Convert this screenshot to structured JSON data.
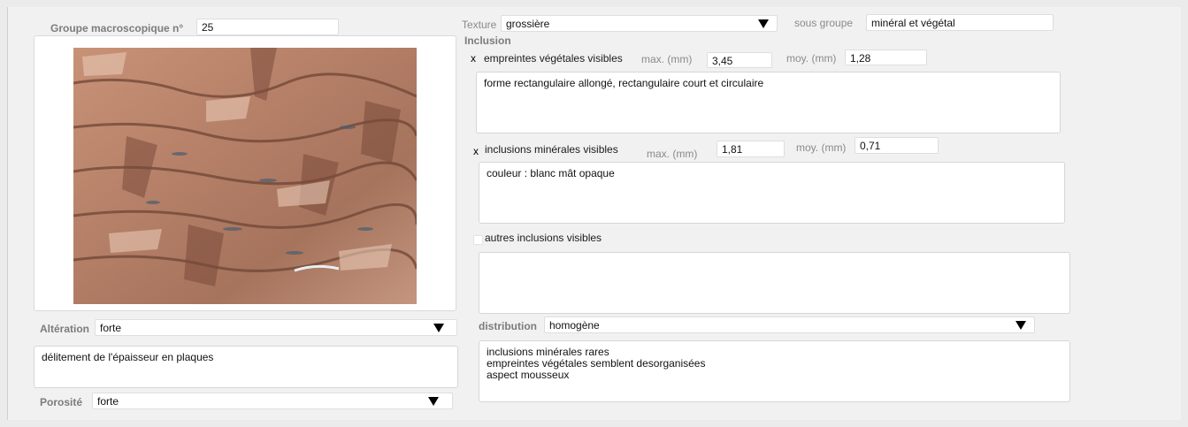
{
  "groupe": {
    "label": "Groupe macroscopique n°",
    "value": "25"
  },
  "texture": {
    "label": "Texture",
    "value": "grossière"
  },
  "sous_groupe": {
    "label": "sous groupe",
    "value": "minéral et végétal"
  },
  "inclusion": {
    "heading": "Inclusion",
    "empreintes": {
      "label": "empreintes végétales visibles",
      "checked_mark": "x",
      "max_label": "max. (mm)",
      "max_value": "3,45",
      "moy_label": "moy. (mm)",
      "moy_value": "1,28",
      "description": "forme rectangulaire allongé, rectangulaire court et circulaire"
    },
    "minerales": {
      "label": "inclusions minérales visibles",
      "checked_mark": "x",
      "max_label": "max. (mm)",
      "max_value": "1,81",
      "moy_label": "moy. (mm)",
      "moy_value": "0,71",
      "description": "couleur : blanc mât opaque"
    },
    "autres": {
      "label": "autres inclusions visibles",
      "description": ""
    }
  },
  "alteration": {
    "label": "Altération",
    "value": "forte",
    "description": "délitement de l'épaisseur en plaques"
  },
  "porosite": {
    "label": "Porosité",
    "value": "forte"
  },
  "distribution": {
    "label": "distribution",
    "value": "homogène",
    "lines": [
      "inclusions minérales rares",
      "empreintes végétales semblent desorganisées",
      "aspect mousseux"
    ]
  },
  "photo": {
    "icon": "rock-sample-photo"
  },
  "colors": {
    "background": "#ebebeb",
    "panel": "#f1f1f1",
    "field": "#ffffff",
    "label": "#7c7c7c"
  }
}
